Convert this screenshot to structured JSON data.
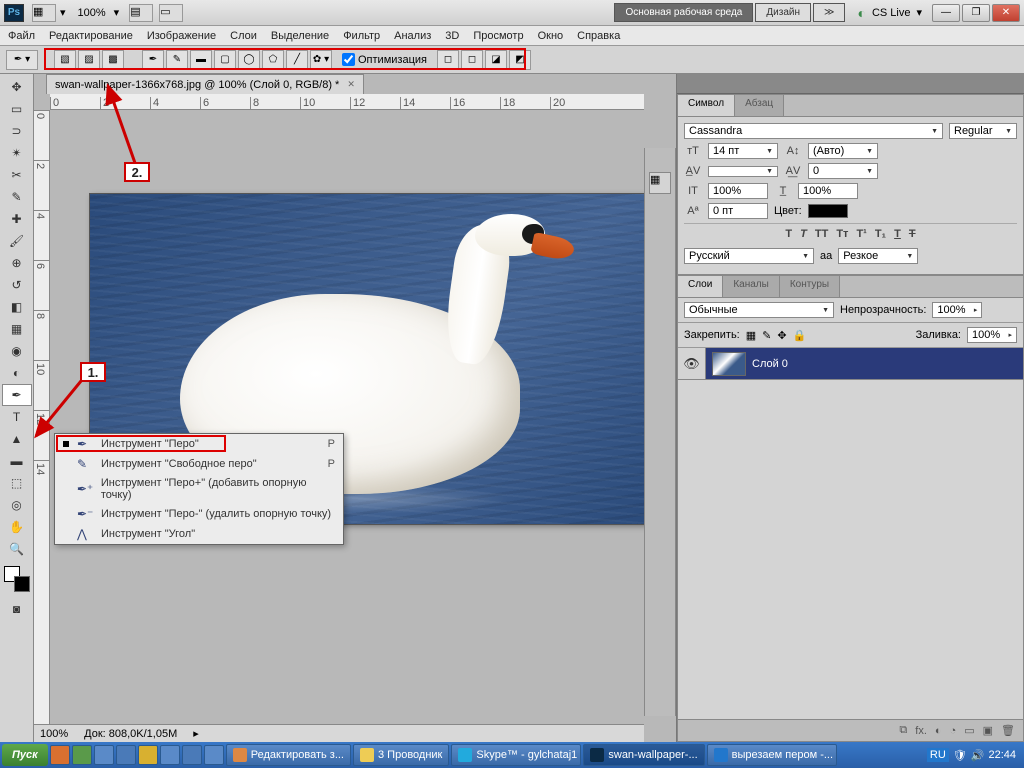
{
  "app": {
    "logo": "Ps",
    "zoom": "100%"
  },
  "workspace": {
    "main": "Основная рабочая среда",
    "design": "Дизайн",
    "cslive": "CS Live"
  },
  "menu": [
    "Файл",
    "Редактирование",
    "Изображение",
    "Слои",
    "Выделение",
    "Фильтр",
    "Анализ",
    "3D",
    "Просмотр",
    "Окно",
    "Справка"
  ],
  "options": {
    "optimize": "Оптимизация"
  },
  "document": {
    "tab": "swan-wallpaper-1366x768.jpg @ 100% (Слой 0, RGB/8) *",
    "zoom_status": "100%",
    "doc_size": "Док: 808,0K/1,05M"
  },
  "flyout": {
    "items": [
      {
        "label": "Инструмент \"Перо\"",
        "shortcut": "P",
        "active": true
      },
      {
        "label": "Инструмент \"Свободное перо\"",
        "shortcut": "P"
      },
      {
        "label": "Инструмент \"Перо+\" (добавить опорную точку)"
      },
      {
        "label": "Инструмент \"Перо-\" (удалить опорную точку)"
      },
      {
        "label": "Инструмент \"Угол\""
      }
    ]
  },
  "callouts": {
    "one": "1.",
    "two": "2."
  },
  "char_panel": {
    "tabs": [
      "Символ",
      "Абзац"
    ],
    "font": "Cassandra",
    "style": "Regular",
    "size": "14 пт",
    "leading": "(Авто)",
    "tracking": "0",
    "vscale": "100%",
    "hscale": "100%",
    "baseline": "0 пт",
    "color_label": "Цвет:",
    "lang": "Русский",
    "aa_label": "aа",
    "aa": "Резкое"
  },
  "layers_panel": {
    "tabs": [
      "Слои",
      "Каналы",
      "Контуры"
    ],
    "blend": "Обычные",
    "opacity_label": "Непрозрачность:",
    "opacity": "100%",
    "lock_label": "Закрепить:",
    "fill_label": "Заливка:",
    "fill": "100%",
    "layer0": "Слой 0"
  },
  "taskbar": {
    "start": "Пуск",
    "tasks": [
      "Редактировать з...",
      "3 Проводник",
      "Skype™ - gylchataj1",
      "swan-wallpaper-...",
      "вырезаем пером -..."
    ],
    "clock": "22:44",
    "lang": "RU"
  }
}
